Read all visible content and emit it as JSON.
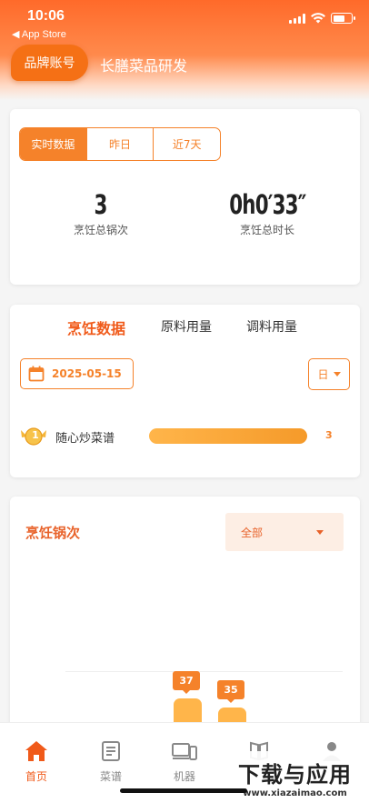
{
  "status_bar": {
    "time": "10:06",
    "back_label": "◀ App Store"
  },
  "header": {
    "brand_button": "品牌账号",
    "brand_name": "长膳菜品研发"
  },
  "overview": {
    "segments": [
      "实时数据",
      "昨日",
      "近7天"
    ],
    "active_segment": 0,
    "stats": [
      {
        "value": "3",
        "label": "烹饪总锅次"
      },
      {
        "value": "0h0′33″",
        "label": "烹饪总时长"
      }
    ]
  },
  "cooking_data": {
    "tabs": [
      "烹饪数据",
      "原料用量",
      "调料用量"
    ],
    "active_tab": 0,
    "date": "2025-05-15",
    "unit": "日",
    "ranking": [
      {
        "rank": "1",
        "name": "随心炒菜谱",
        "value": "3",
        "fill": 1.0
      }
    ]
  },
  "cooking_times": {
    "title": "烹饪锅次",
    "filter": "全部",
    "bars": [
      {
        "label": "37",
        "value": 37
      },
      {
        "label": "35",
        "value": 35
      }
    ]
  },
  "tabbar": {
    "items": [
      {
        "label": "首页",
        "icon": "home-icon",
        "active": true
      },
      {
        "label": "菜谱",
        "icon": "recipe-icon",
        "active": false
      },
      {
        "label": "机器",
        "icon": "device-icon",
        "active": false
      },
      {
        "label": "",
        "icon": "book-icon",
        "active": false
      },
      {
        "label": "",
        "icon": "user-icon",
        "active": false
      }
    ]
  },
  "watermark": {
    "title": "下载与应用",
    "url": "www.xiazaimao.com"
  },
  "colors": {
    "accent": "#f5822a",
    "header": "#ff6a2a",
    "active_tab": "#f05a1a"
  }
}
